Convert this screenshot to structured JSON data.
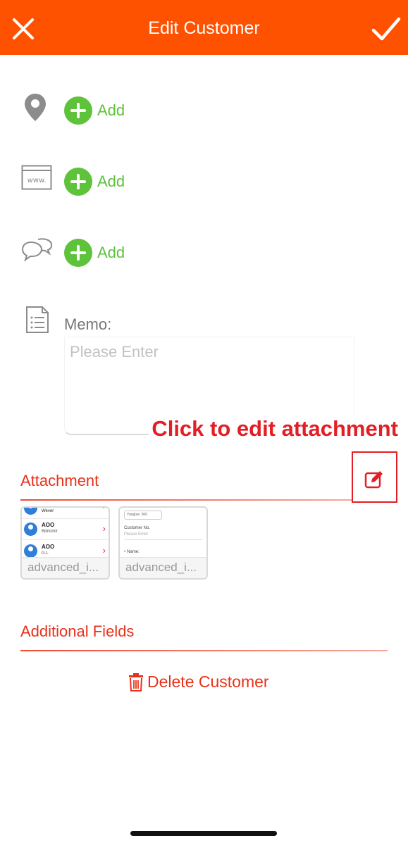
{
  "header": {
    "title": "Edit Customer",
    "close_icon": "close-icon",
    "confirm_icon": "checkmark-icon",
    "background": "#ff5200"
  },
  "contact_rows": [
    {
      "icon": "location-pin-icon",
      "add_label": "Add"
    },
    {
      "icon": "website-icon",
      "add_label": "Add"
    },
    {
      "icon": "chat-bubbles-icon",
      "add_label": "Add"
    }
  ],
  "memo": {
    "icon": "document-list-icon",
    "label": "Memo:",
    "placeholder": "Please Enter",
    "value": ""
  },
  "callout": {
    "text": "Click to edit attachment",
    "color": "#e31e24"
  },
  "attachment": {
    "title": "Attachment",
    "edit_icon": "edit-icon",
    "files": [
      {
        "name": "advanced_i...",
        "preview": {
          "rows": [
            {
              "name": "Wever",
              "sub": ""
            },
            {
              "name": "AOO",
              "sub": "Bilirkimir"
            },
            {
              "name": "AOO",
              "sub": "G.L"
            }
          ]
        }
      },
      {
        "name": "advanced_i...",
        "preview": {
          "select": "Yangtse: 000",
          "field_label": "Customer No.",
          "field_placeholder": "Please Enter",
          "required_label": "Name:"
        }
      }
    ]
  },
  "additional_fields": {
    "title": "Additional Fields"
  },
  "delete": {
    "label": "Delete Customer",
    "icon": "trash-icon",
    "color": "#e8311a"
  },
  "accent_green": "#5ec23a"
}
